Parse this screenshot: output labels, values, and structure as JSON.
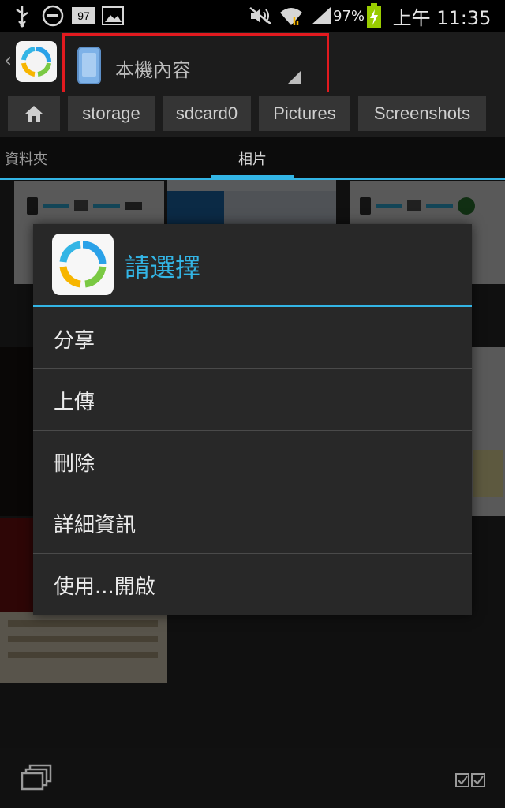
{
  "status_bar": {
    "icons": [
      "usb-icon",
      "do-not-disturb-icon",
      "notification-badge-icon",
      "image-icon",
      "mute-icon",
      "wifi-icon",
      "signal-icon",
      "battery-charging-icon"
    ],
    "notification_badge": "97",
    "battery_percent": "97%",
    "time": "上午 11:35"
  },
  "action_bar": {
    "location_label": "本機內容"
  },
  "breadcrumb": {
    "items": [
      "storage",
      "sdcard0",
      "Pictures",
      "Screenshots"
    ]
  },
  "tabs": {
    "items": [
      "資料夾",
      "相片"
    ],
    "active": "相片"
  },
  "dialog": {
    "title": "請選擇",
    "items": [
      "分享",
      "上傳",
      "刪除",
      "詳細資訊",
      "使用...開啟"
    ]
  },
  "colors": {
    "accent": "#33b5e5",
    "highlight_box": "#e11a1f"
  }
}
